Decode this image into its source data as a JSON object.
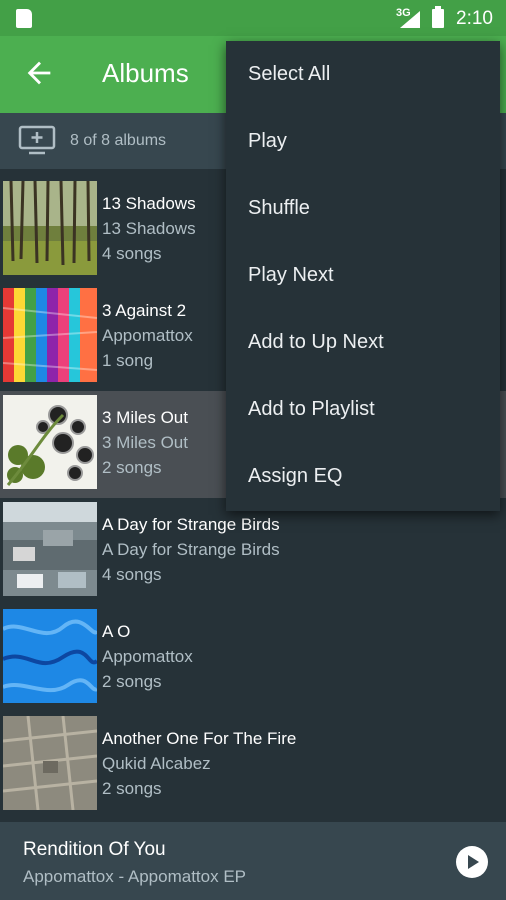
{
  "status_bar": {
    "network": "3G",
    "time": "2:10"
  },
  "app_bar": {
    "title": "Albums"
  },
  "sub_bar": {
    "count": "8 of 8 albums"
  },
  "albums": [
    {
      "title": "13 Shadows",
      "artist": "13 Shadows",
      "songs": "4 songs"
    },
    {
      "title": "3 Against 2",
      "artist": "Appomattox",
      "songs": "1 song"
    },
    {
      "title": "3 Miles Out",
      "artist": "3 Miles Out",
      "songs": "2 songs"
    },
    {
      "title": "A Day for Strange Birds",
      "artist": "A Day for Strange Birds",
      "songs": "4 songs"
    },
    {
      "title": "A O",
      "artist": "Appomattox",
      "songs": "2 songs"
    },
    {
      "title": "Another One For The Fire",
      "artist": "Qukid Alcabez",
      "songs": "2 songs"
    }
  ],
  "menu": {
    "items": [
      "Select All",
      "Play",
      "Shuffle",
      "Play Next",
      "Add to Up Next",
      "Add to Playlist",
      "Assign EQ"
    ]
  },
  "now_playing": {
    "title": "Rendition Of You",
    "subtitle": "Appomattox - Appomattox EP"
  },
  "colors": {
    "status_bar": "#43a047",
    "app_bar": "#4caf50",
    "background": "#263238",
    "sub_bar": "#37474f"
  }
}
